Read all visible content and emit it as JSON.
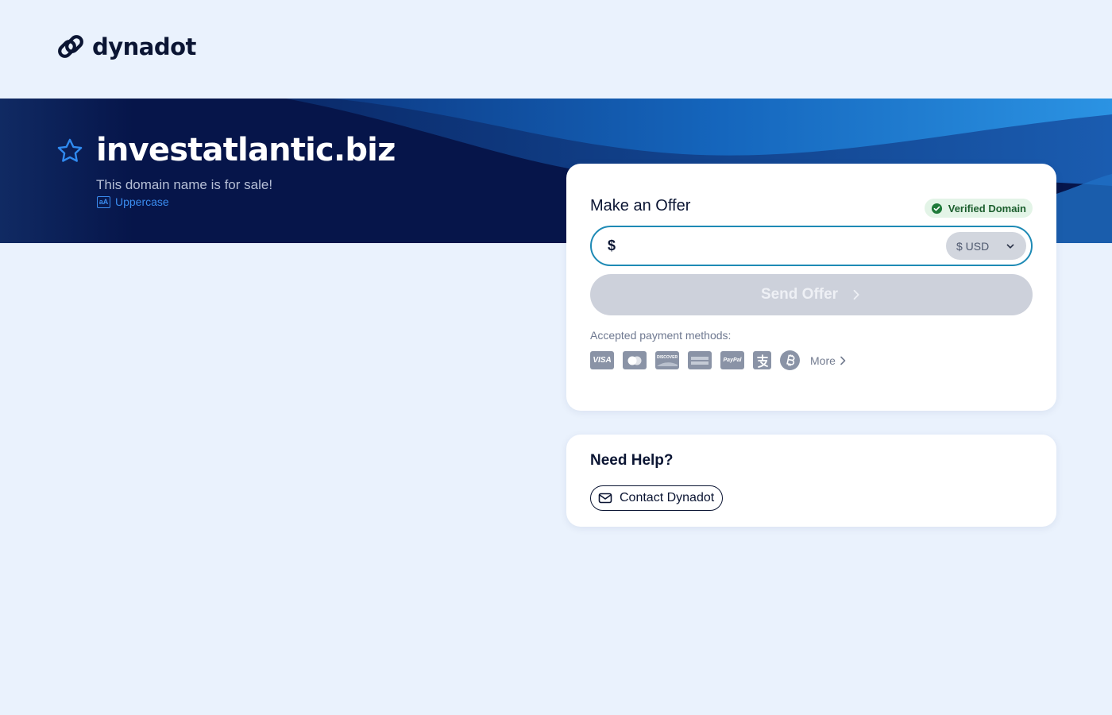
{
  "header": {
    "logo_text": "dynadot",
    "logo_icon": "link-chain-icon"
  },
  "hero": {
    "domain": "investatlantic.biz",
    "subtitle": "This domain name is for sale!",
    "uppercase_label": "Uppercase",
    "uppercase_icon_text": "aA",
    "star_icon": "star-outline-icon"
  },
  "offer": {
    "title": "Make an Offer",
    "verified_label": "Verified Domain",
    "currency_symbol": "$",
    "input_value": "",
    "currency_selected": "$ USD",
    "send_label": "Send Offer",
    "payment_label": "Accepted payment methods:",
    "payment_methods": [
      "VISA",
      "Mastercard",
      "DISCOVER",
      "American Express",
      "PayPal",
      "Alipay",
      "Bitcoin"
    ],
    "more_label": "More"
  },
  "help": {
    "title": "Need Help?",
    "contact_label": "Contact Dynadot"
  },
  "colors": {
    "page_bg": "#eaf2fd",
    "hero_dark": "#06154a",
    "hero_accent": "#2a8fe0",
    "input_border": "#1e8ab5",
    "send_disabled": "#cdd1db",
    "verified_bg": "#e3f4e7",
    "verified_text": "#1b5e2d",
    "link_blue": "#3b8df0"
  }
}
